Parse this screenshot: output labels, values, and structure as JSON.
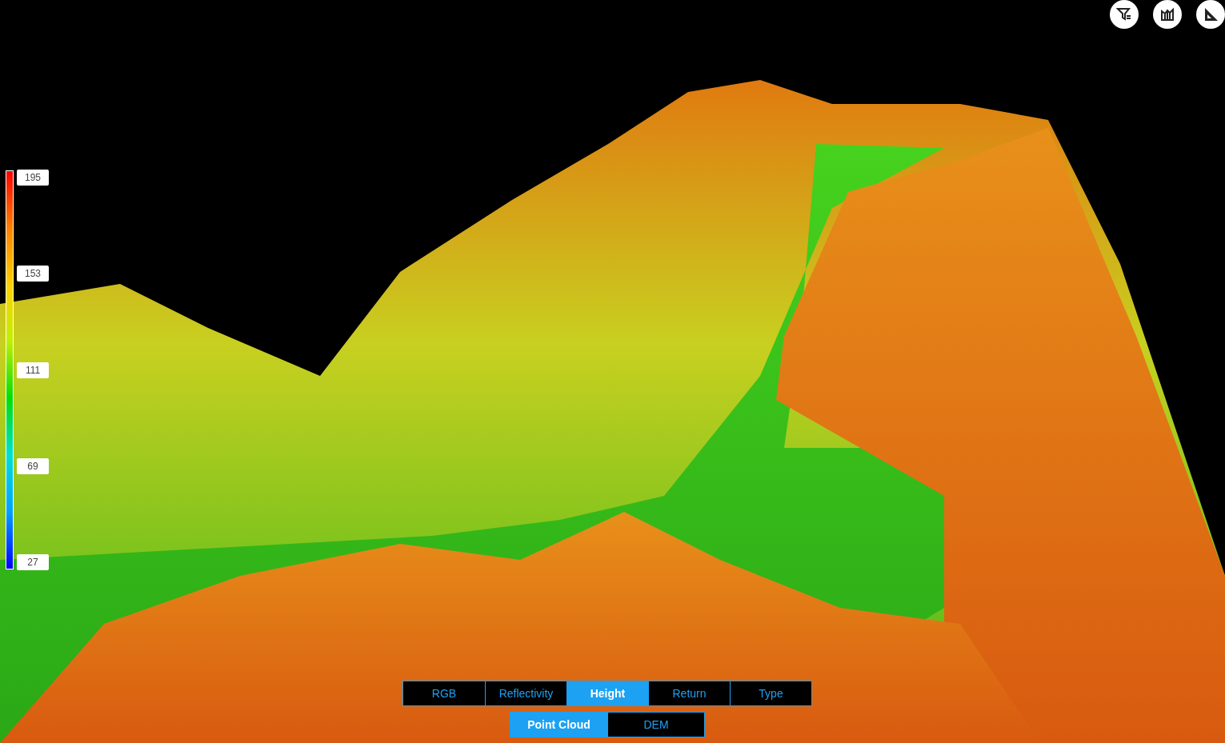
{
  "toolbar": {
    "buttons": [
      {
        "kind": "filter"
      },
      {
        "kind": "profile"
      },
      {
        "kind": "measure"
      }
    ]
  },
  "legend": {
    "labels": [
      "195",
      "153",
      "111",
      "69",
      "27"
    ]
  },
  "color_modes": [
    {
      "label": "RGB",
      "selected": false
    },
    {
      "label": "Reflectivity",
      "selected": false
    },
    {
      "label": "Height",
      "selected": true
    },
    {
      "label": "Return",
      "selected": false
    },
    {
      "label": "Type",
      "selected": false
    }
  ],
  "view_modes": [
    {
      "label": "Point Cloud",
      "selected": true
    },
    {
      "label": "DEM",
      "selected": false
    }
  ]
}
